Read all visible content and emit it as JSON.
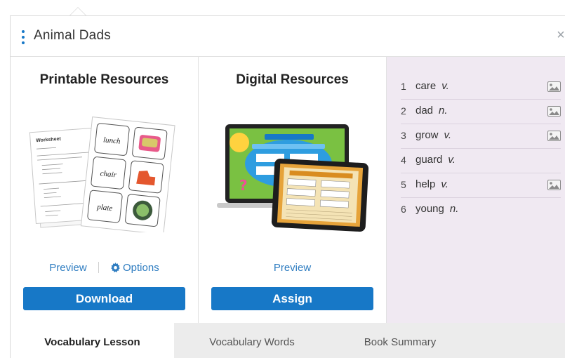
{
  "header": {
    "title": "Animal Dads",
    "close_glyph": "×"
  },
  "printable": {
    "title": "Printable Resources",
    "thumbnail": {
      "worksheet_heading": "Worksheet",
      "cards": [
        "lunch",
        "chair",
        "plate"
      ]
    },
    "preview_label": "Preview",
    "options_label": "Options",
    "download_label": "Download"
  },
  "digital": {
    "title": "Digital Resources",
    "preview_label": "Preview",
    "assign_label": "Assign"
  },
  "vocabulary": [
    {
      "num": "1",
      "word": "care",
      "pos": "v.",
      "has_image": true
    },
    {
      "num": "2",
      "word": "dad",
      "pos": "n.",
      "has_image": true
    },
    {
      "num": "3",
      "word": "grow",
      "pos": "v.",
      "has_image": true
    },
    {
      "num": "4",
      "word": "guard",
      "pos": "v.",
      "has_image": false
    },
    {
      "num": "5",
      "word": "help",
      "pos": "v.",
      "has_image": true
    },
    {
      "num": "6",
      "word": "young",
      "pos": "n.",
      "has_image": false
    }
  ],
  "tabs": [
    {
      "label": "Vocabulary Lesson",
      "active": true
    },
    {
      "label": "Vocabulary Words",
      "active": false
    },
    {
      "label": "Book Summary",
      "active": false
    }
  ],
  "colors": {
    "accent": "#1778c7",
    "link": "#2f7dc1",
    "vocab_panel_bg": "#f0e9f2",
    "inactive_tab_bg": "#ececec"
  }
}
